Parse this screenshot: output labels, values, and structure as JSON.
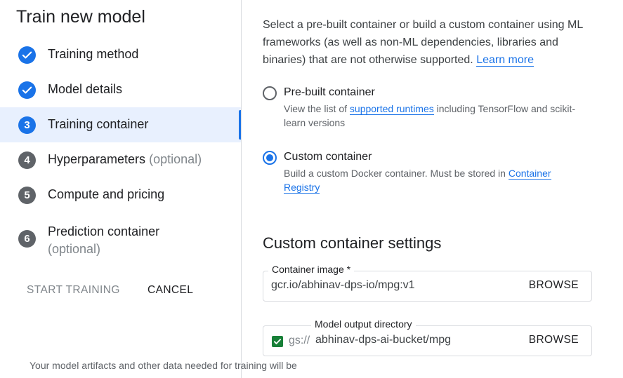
{
  "panel": {
    "title": "Train new model",
    "steps": [
      {
        "badge": "",
        "label": "Training method",
        "optional": "",
        "state": "done"
      },
      {
        "badge": "",
        "label": "Model details",
        "optional": "",
        "state": "done"
      },
      {
        "badge": "3",
        "label": "Training container",
        "optional": "",
        "state": "current"
      },
      {
        "badge": "4",
        "label": "Hyperparameters",
        "optional": "(optional)",
        "state": "todo"
      },
      {
        "badge": "5",
        "label": "Compute and pricing",
        "optional": "",
        "state": "todo"
      },
      {
        "badge": "6",
        "label": "Prediction container",
        "optional": "(optional)",
        "state": "todo"
      }
    ],
    "start_label": "START TRAINING",
    "cancel_label": "CANCEL"
  },
  "content": {
    "intro_text": "Select a pre-built container or build a custom container using ML frameworks (as well as non-ML dependencies, libraries and binaries) that are not otherwise supported.",
    "intro_link": "Learn more",
    "prebuilt": {
      "title": "Pre-built container",
      "desc_before": "View the list of",
      "desc_link": "supported runtimes",
      "desc_after": "including TensorFlow and scikit-learn versions",
      "selected": false
    },
    "custom": {
      "title": "Custom container",
      "desc_before": "Build a custom Docker container. Must be stored in",
      "desc_link": "Container Registry",
      "selected": true
    },
    "section_title": "Custom container settings",
    "image_field": {
      "label": "Container image *",
      "value": "gcr.io/abhinav-dps-io/mpg:v1",
      "browse": "BROWSE"
    },
    "output_field": {
      "label": "Model output directory",
      "prefix": "gs://",
      "value": "abhinav-dps-ai-bucket/mpg",
      "browse": "BROWSE"
    },
    "help_text": "Your model artifacts and other data needed for training will be"
  },
  "colors": {
    "accent": "#1a73e8",
    "active_bg": "#e8f0fe",
    "todo_badge": "#5f6368",
    "check_green": "#188038"
  }
}
